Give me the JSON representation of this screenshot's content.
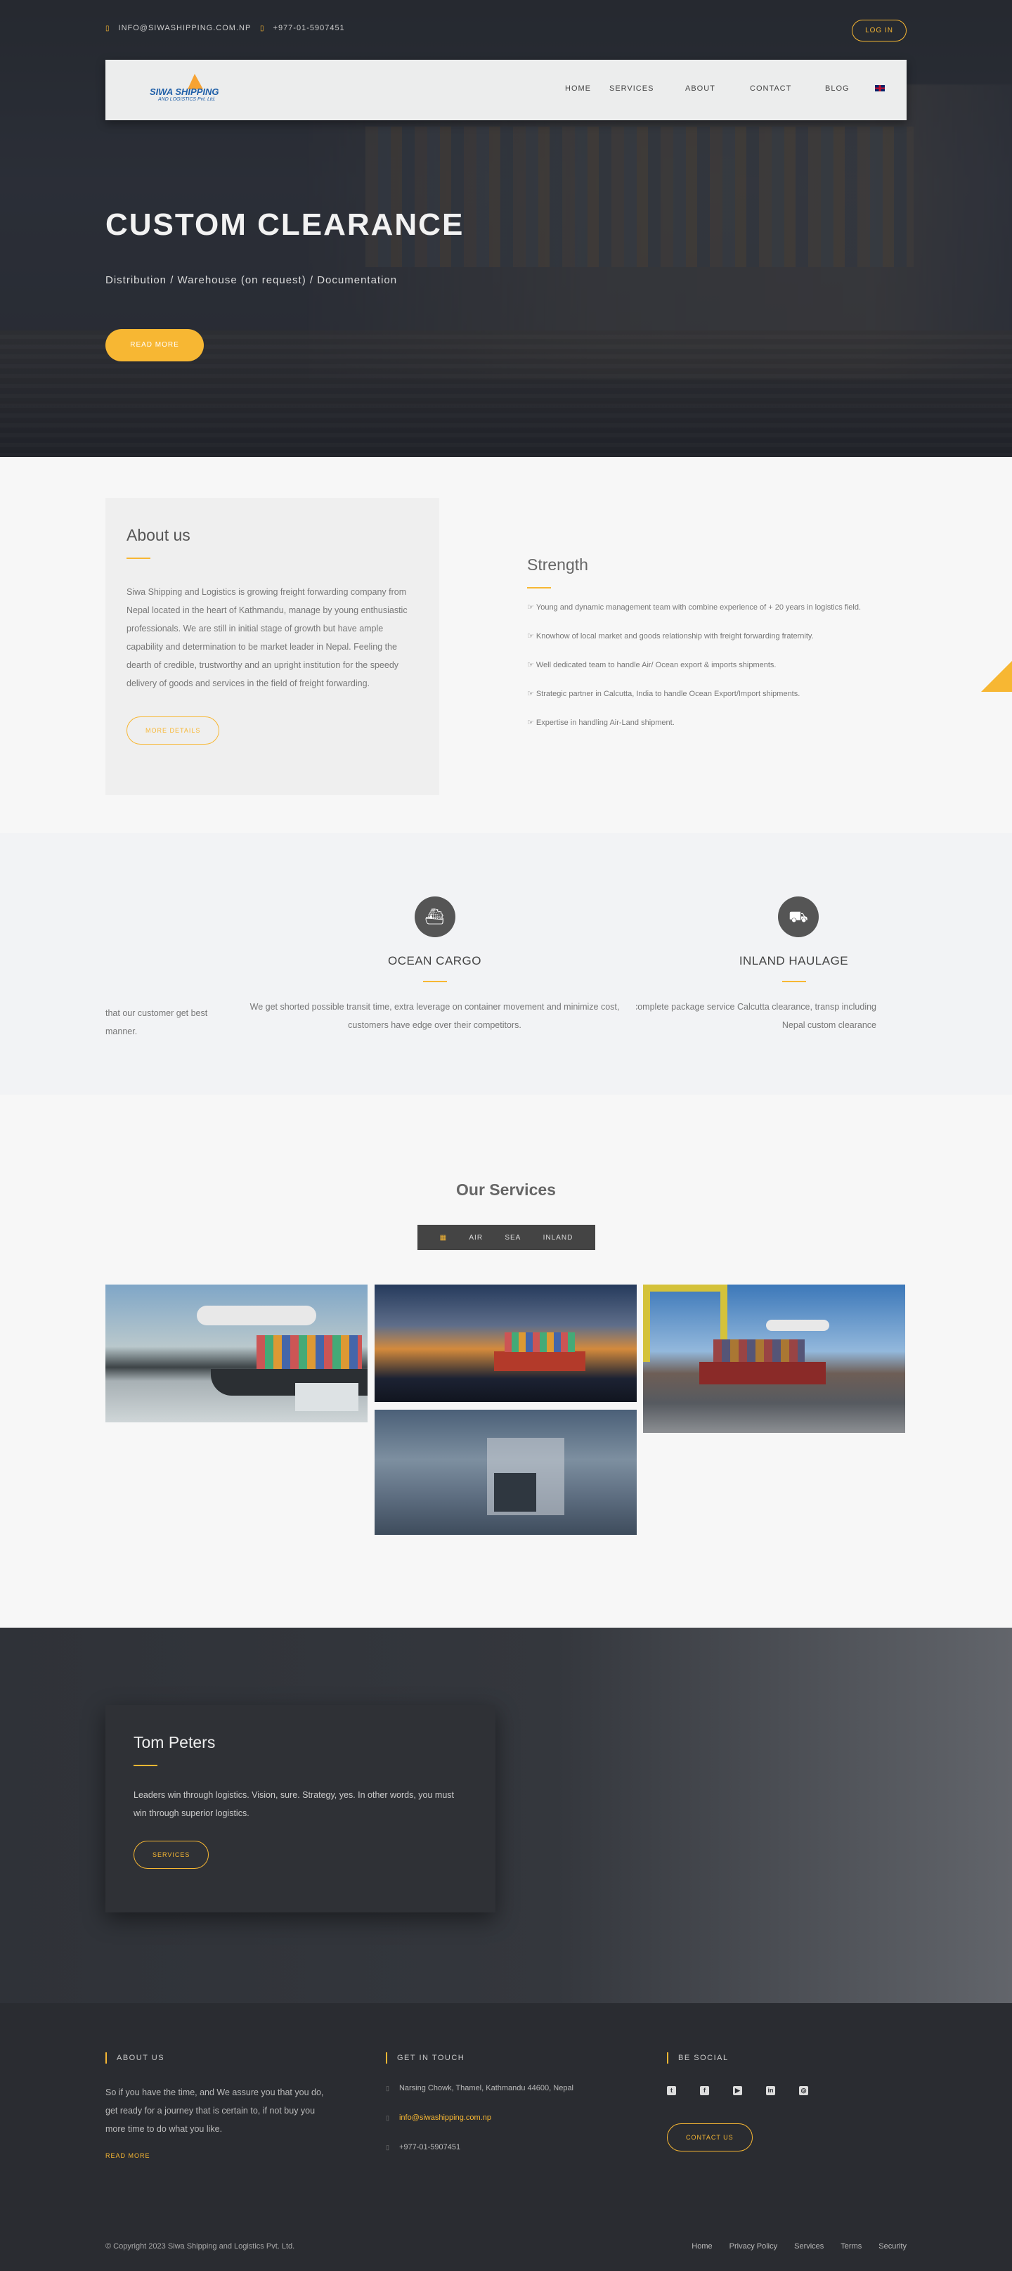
{
  "topbar": {
    "email": "INFO@SIWASHIPPING.COM.NP",
    "phone": "+977-01-5907451",
    "login": "LOG IN"
  },
  "logo": {
    "line1": "SIWA SHIPPING",
    "line2": "AND LOGISTICS Pvt. Ltd."
  },
  "nav": {
    "items": [
      "HOME",
      "SERVICES",
      "ABOUT",
      "CONTACT",
      "BLOG"
    ],
    "language_icon": "uk-flag-icon"
  },
  "hero": {
    "title": "CUSTOM CLEARANCE",
    "subtitle": "Distribution / Warehouse (on request) / Documentation",
    "button": "READ MORE"
  },
  "about": {
    "title": "About us",
    "text": "Siwa Shipping and Logistics is growing freight forwarding company from Nepal located in the heart of Kathmandu, manage by young enthusiastic professionals. We are still in initial stage of growth but have ample capability and determination to be market leader in Nepal. Feeling the dearth of credible, trustworthy and an upright institution for the speedy delivery of goods and services in the field of freight forwarding.",
    "button": "MORE DETAILS"
  },
  "strength": {
    "title": "Strength",
    "items": [
      "Young and dynamic management team with combine experience of + 20 years in logistics field.",
      "Knowhow of local market and goods relationship with freight forwarding fraternity.",
      "Well dedicated team to handle Air/ Ocean export & imports shipments.",
      "Strategic partner in Calcutta, India to handle Ocean Export/Import shipments.",
      "Expertise in handling Air-Land shipment."
    ]
  },
  "strip": {
    "left_text": "that our customer get best\nmanner.",
    "services": [
      {
        "title": "OCEAN CARGO",
        "icon": "ship-icon",
        "desc": "We get shorted possible transit time, extra leverage on container movement and minimize cost, customers have edge over their competitors."
      },
      {
        "title": "INLAND HAULAGE",
        "icon": "truck-icon",
        "desc": "We offer complete package service Calcutta clearance, transp including Nepal custom clearance"
      }
    ]
  },
  "our_services": {
    "title": "Our Services",
    "filters": [
      "AIR",
      "SEA",
      "INLAND"
    ],
    "filter_all_icon": "grid-icon"
  },
  "testimonial": {
    "name": "Tom Peters",
    "quote": "Leaders win through logistics. Vision, sure. Strategy, yes. In other words, you must win through superior logistics.",
    "button": "SERVICES"
  },
  "footer": {
    "about_title": "ABOUT US",
    "about_text": "So if you have the time, and We assure you that you do, get ready for a journey that is certain to, if not buy you more time to do what you like.",
    "about_link": "READ MORE",
    "contact_title": "GET IN TOUCH",
    "address": "Narsing Chowk, Thamel, Kathmandu 44600, Nepal",
    "email": "info@siwashipping.com.np",
    "phone": "+977-01-5907451",
    "social_title": "BE SOCIAL",
    "social_icons": [
      "twitter-icon",
      "facebook-icon",
      "youtube-icon",
      "linkedin-icon",
      "instagram-icon"
    ],
    "contact_button": "CONTACT US",
    "copyright": "© Copyright 2023 Siwa Shipping and Logistics Pvt. Ltd.",
    "links": [
      "Home",
      "Privacy Policy",
      "Services",
      "Terms",
      "Security"
    ]
  }
}
